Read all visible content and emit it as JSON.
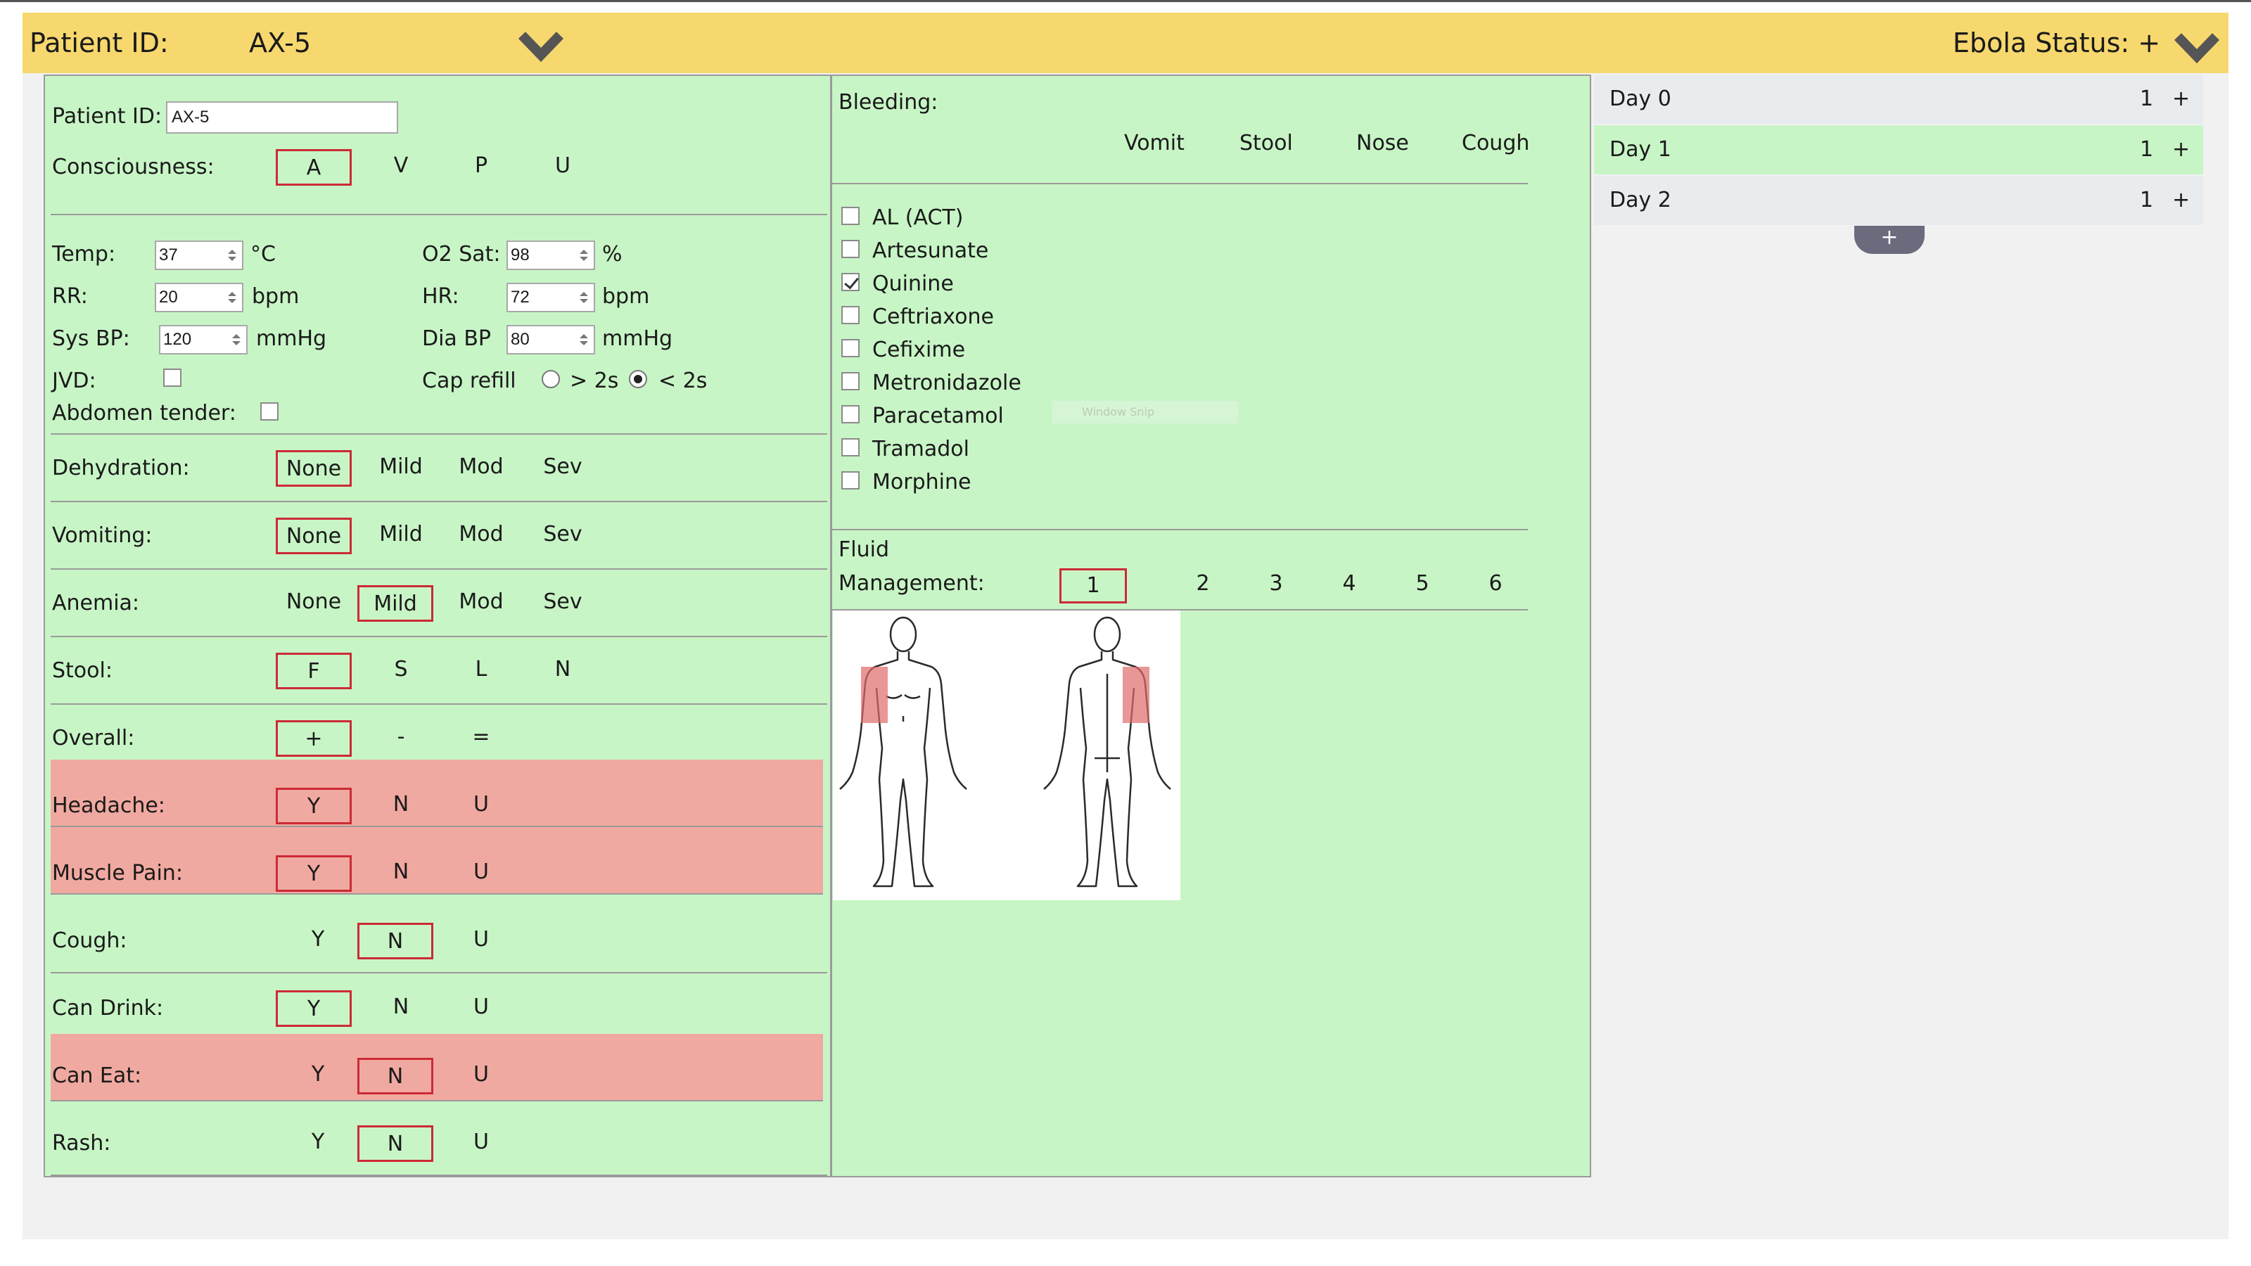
{
  "header": {
    "patient_id_label": "Patient ID:",
    "patient_id_value": "AX-5",
    "ebola_status_label": "Ebola Status: +",
    "icons": [
      "chevron-down-icon",
      "chevron-down-icon"
    ]
  },
  "form": {
    "patient_id_label": "Patient ID:",
    "patient_id_value": "AX-5",
    "consciousness": {
      "label": "Consciousness:",
      "options": [
        "A",
        "V",
        "P",
        "U"
      ],
      "selected": "A"
    },
    "vitals": {
      "temp": {
        "label": "Temp:",
        "value": "37",
        "unit": "°C"
      },
      "o2sat": {
        "label": "O2 Sat:",
        "value": "98",
        "unit": "%"
      },
      "rr": {
        "label": "RR:",
        "value": "20",
        "unit": "bpm"
      },
      "hr": {
        "label": "HR:",
        "value": "72",
        "unit": "bpm"
      },
      "sysbp": {
        "label": "Sys BP:",
        "value": "120",
        "unit": "mmHg"
      },
      "diabp": {
        "label": "Dia BP",
        "value": "80",
        "unit": "mmHg"
      },
      "jvd": {
        "label": "JVD:",
        "checked": false
      },
      "abdomen": {
        "label": "Abdomen tender:",
        "checked": false
      },
      "caprefill": {
        "label": "Cap refill",
        "opt1": "> 2s",
        "opt2": "< 2s",
        "selected": "< 2s"
      }
    },
    "dehydration": {
      "label": "Dehydration:",
      "options": [
        "None",
        "Mild",
        "Mod",
        "Sev"
      ],
      "selected": "None"
    },
    "vomiting": {
      "label": "Vomiting:",
      "options": [
        "None",
        "Mild",
        "Mod",
        "Sev"
      ],
      "selected": "None"
    },
    "anemia": {
      "label": "Anemia:",
      "options": [
        "None",
        "Mild",
        "Mod",
        "Sev"
      ],
      "selected": "Mild"
    },
    "stool": {
      "label": "Stool:",
      "options": [
        "F",
        "S",
        "L",
        "N"
      ],
      "selected": "F"
    },
    "overall": {
      "label": "Overall:",
      "options": [
        "+",
        "-",
        "="
      ],
      "selected": "+"
    },
    "headache": {
      "label": "Headache:",
      "options": [
        "Y",
        "N",
        "U"
      ],
      "selected": "Y"
    },
    "musclepain": {
      "label": "Muscle Pain:",
      "options": [
        "Y",
        "N",
        "U"
      ],
      "selected": "Y"
    },
    "cough": {
      "label": "Cough:",
      "options": [
        "Y",
        "N",
        "U"
      ],
      "selected": "N"
    },
    "candrink": {
      "label": "Can Drink:",
      "options": [
        "Y",
        "N",
        "U"
      ],
      "selected": "Y"
    },
    "caneat": {
      "label": "Can Eat:",
      "options": [
        "Y",
        "N",
        "U"
      ],
      "selected": "N"
    },
    "rash": {
      "label": "Rash:",
      "options": [
        "Y",
        "N",
        "U"
      ],
      "selected": "N"
    }
  },
  "right": {
    "bleeding_label": "Bleeding:",
    "bleeding_cols": [
      "Vomit",
      "Stool",
      "Nose",
      "Cough"
    ],
    "medications": [
      {
        "name": "AL (ACT)",
        "checked": false
      },
      {
        "name": "Artesunate",
        "checked": false
      },
      {
        "name": "Quinine",
        "checked": true
      },
      {
        "name": "Ceftriaxone",
        "checked": false
      },
      {
        "name": "Cefixime",
        "checked": false
      },
      {
        "name": "Metronidazole",
        "checked": false
      },
      {
        "name": "Paracetamol",
        "checked": false
      },
      {
        "name": "Tramadol",
        "checked": false
      },
      {
        "name": "Morphine",
        "checked": false
      }
    ],
    "faint_overlay": "Window Snip",
    "fluid_label_1": "Fluid",
    "fluid_label_2": "Management:",
    "fluid_options": [
      "1",
      "2",
      "3",
      "4",
      "5",
      "6"
    ],
    "fluid_selected": "1"
  },
  "days": [
    {
      "name": "Day 0",
      "count": "1",
      "plus": "+",
      "active": false
    },
    {
      "name": "Day 1",
      "count": "1",
      "plus": "+",
      "active": true
    },
    {
      "name": "Day 2",
      "count": "1",
      "plus": "+",
      "active": false
    }
  ],
  "add_day_label": "+",
  "colors": {
    "header_bg": "#f6d86e",
    "panel_bg": "#c8f5c6",
    "alert_row_bg": "#f0a9a0",
    "selected_border": "#cc2a36",
    "day_active_bg": "#c8f5c6",
    "day_inactive_bg": "#e8ecee"
  }
}
